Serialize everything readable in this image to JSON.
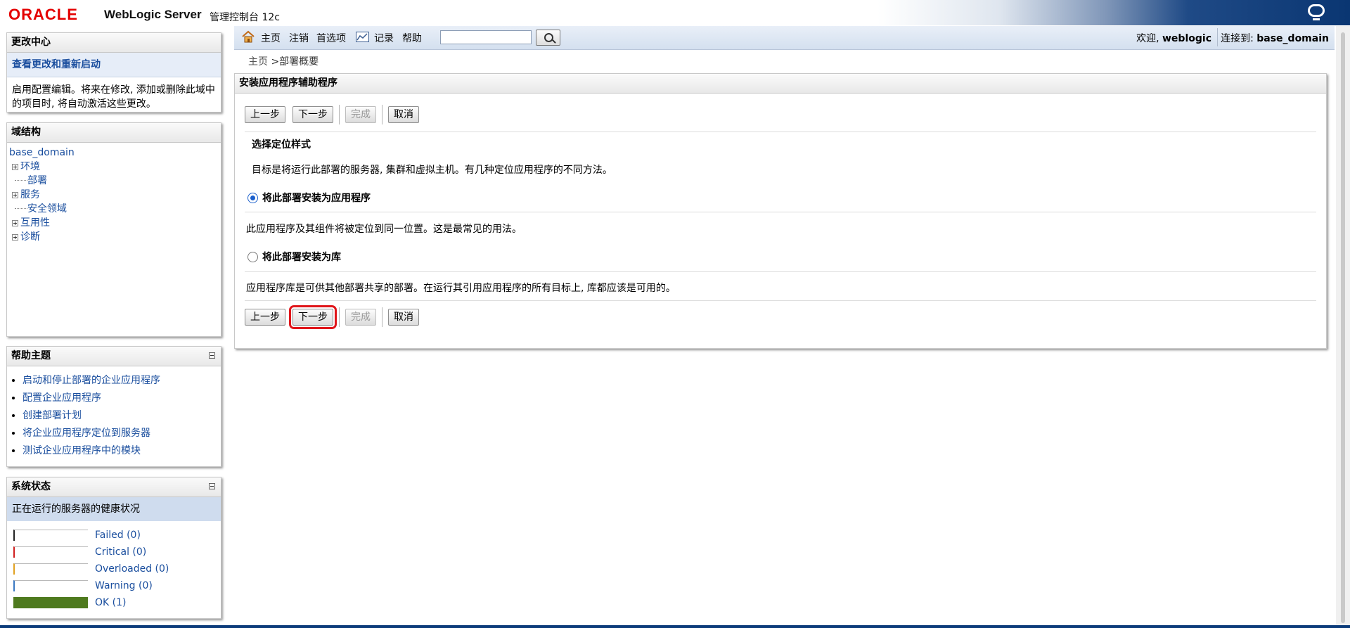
{
  "header": {
    "brand": "ORACLE",
    "product": "WebLogic Server",
    "subtitle": "管理控制台 12c"
  },
  "toolbar": {
    "home": "主页",
    "logout": "注销",
    "preferences": "首选项",
    "record": "记录",
    "help": "帮助",
    "search_value": "",
    "welcome_prefix": "欢迎,",
    "username": "weblogic",
    "connected_prefix": "连接到:",
    "domain": "base_domain"
  },
  "breadcrumb": {
    "home": "主页",
    "current": ">部署概要"
  },
  "change_center": {
    "title": "更改中心",
    "link": "查看更改和重新启动",
    "text": "启用配置编辑。将来在修改, 添加或删除此域中的项目时, 将自动激活这些更改。"
  },
  "domain_structure": {
    "title": "域结构",
    "root": "base_domain",
    "items": [
      {
        "label": "环境",
        "expandable": true
      },
      {
        "label": "部署",
        "expandable": false
      },
      {
        "label": "服务",
        "expandable": true
      },
      {
        "label": "安全领域",
        "expandable": false
      },
      {
        "label": "互用性",
        "expandable": true
      },
      {
        "label": "诊断",
        "expandable": true
      }
    ]
  },
  "help_topics": {
    "title": "帮助主题",
    "items": [
      "启动和停止部署的企业应用程序",
      "配置企业应用程序",
      "创建部署计划",
      "将企业应用程序定位到服务器",
      "测试企业应用程序中的模块"
    ]
  },
  "system_status": {
    "title": "系统状态",
    "subtitle": "正在运行的服务器的健康状况",
    "rows": [
      {
        "label": "Failed (0)",
        "color": "#222222",
        "fill": 0
      },
      {
        "label": "Critical (0)",
        "color": "#d01f1f",
        "fill": 0
      },
      {
        "label": "Overloaded (0)",
        "color": "#e0a020",
        "fill": 0
      },
      {
        "label": "Warning (0)",
        "color": "#3a78c2",
        "fill": 0
      },
      {
        "label": "OK (1)",
        "color": "#4e7a1e",
        "fill": 1
      }
    ]
  },
  "wizard": {
    "title": "安装应用程序辅助程序",
    "buttons": {
      "back": "上一步",
      "next": "下一步",
      "finish": "完成",
      "cancel": "取消"
    },
    "heading": "选择定位样式",
    "description": "目标是将运行此部署的服务器, 集群和虚拟主机。有几种定位应用程序的不同方法。",
    "option_app": "将此部署安装为应用程序",
    "option_app_desc": "此应用程序及其组件将被定位到同一位置。这是最常见的用法。",
    "option_lib": "将此部署安装为库",
    "option_lib_desc": "应用程序库是可供其他部署共享的部署。在运行其引用应用程序的所有目标上, 库都应该是可用的。",
    "selected": "app"
  }
}
